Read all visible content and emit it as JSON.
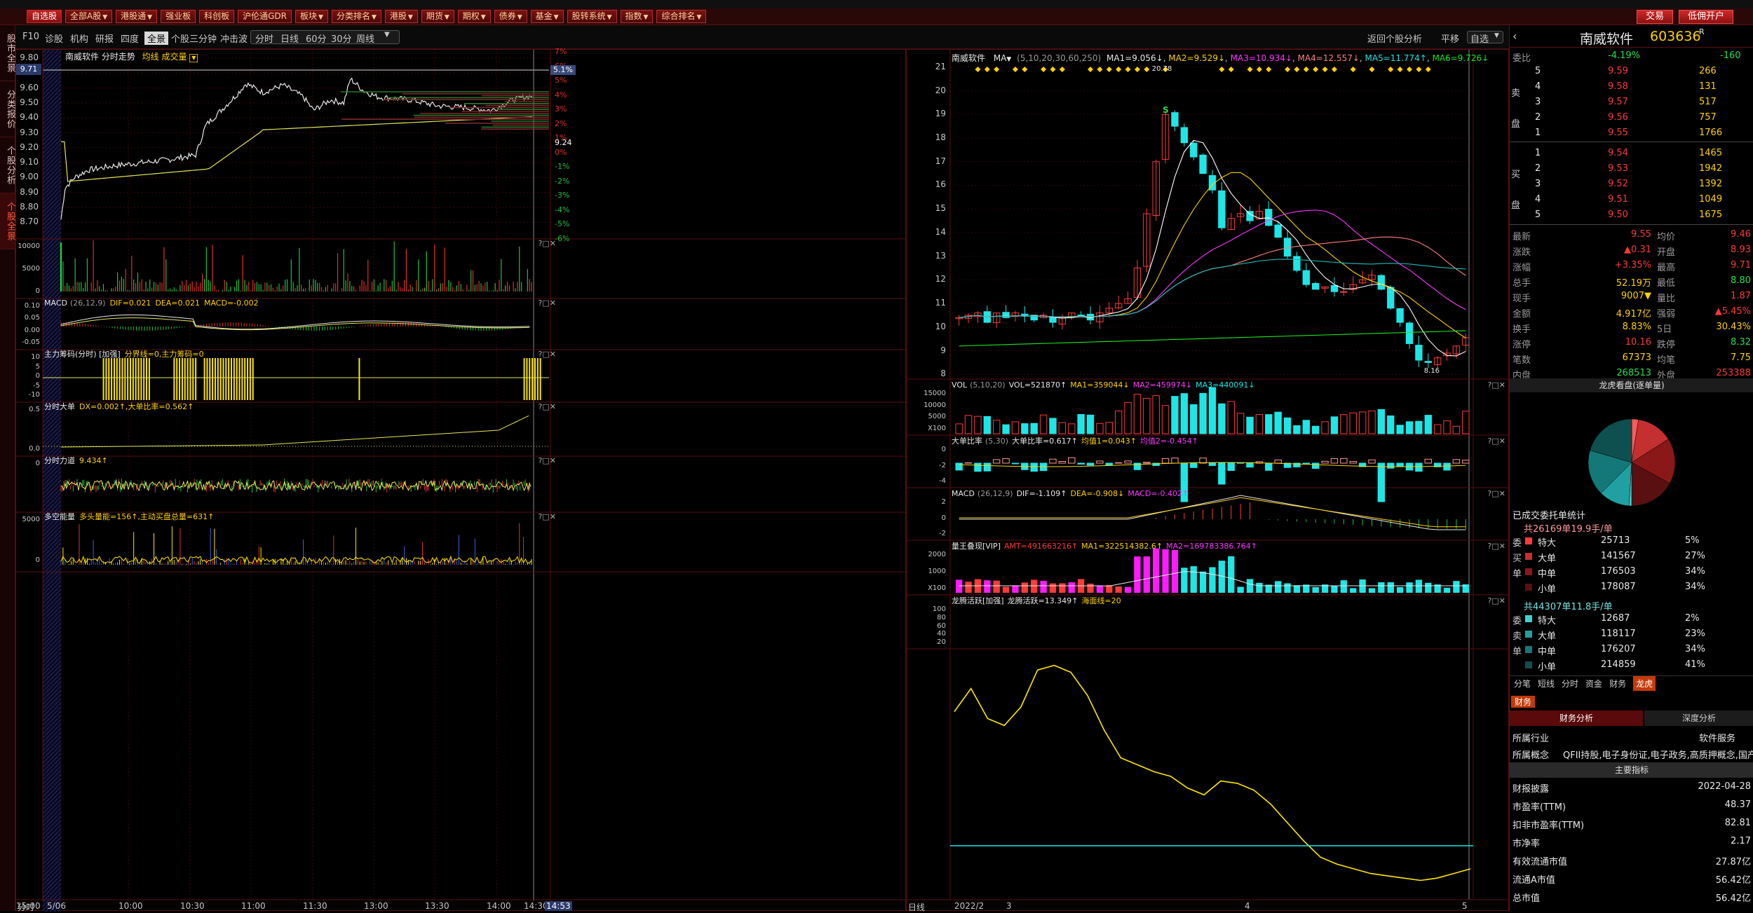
{
  "topbar": {
    "text": ""
  },
  "menu": {
    "items": [
      "自选股",
      "全部A股",
      "港股通",
      "强业板",
      "科创板",
      "沪伦通GDR",
      "板块",
      "分类排名",
      "港股",
      "期货",
      "期权",
      "债券",
      "基金",
      "股转系统",
      "指数",
      "综合排名"
    ],
    "has_arrow": [
      false,
      true,
      true,
      false,
      false,
      false,
      true,
      true,
      true,
      true,
      true,
      true,
      true,
      true,
      true,
      true
    ],
    "active_index": 0,
    "right_buttons": [
      "交易",
      "低佣开户"
    ]
  },
  "sidetabs": [
    "股市全景",
    "分类报价",
    "个股分析",
    "个股全景"
  ],
  "toolbar": {
    "left": [
      "F10",
      "诊股",
      "机构",
      "研报",
      "四度",
      "全景",
      "个股三分钟",
      "冲击波"
    ],
    "period": [
      "分时",
      "日线",
      "60分",
      "30分",
      "周线"
    ],
    "right": [
      "返回个股分析",
      "平移",
      "自选"
    ]
  },
  "intraday": {
    "title": "南威软件  分时走势",
    "title2": "均线 成交量",
    "price_ticks": [
      "9.80",
      "9.70",
      "9.60",
      "9.50",
      "9.40",
      "9.30",
      "9.20",
      "9.10",
      "9.00",
      "8.90",
      "8.80",
      "8.70"
    ],
    "pct_ticks": [
      "7%",
      "6%",
      "5%",
      "4%",
      "3%",
      "2%",
      "1%",
      "0%",
      "-1%",
      "-2%",
      "-3%",
      "-4%",
      "-5%",
      "-6%"
    ],
    "cursor_price": "9.71",
    "cursor_pct": "5.1%",
    "last_label": "9.24",
    "time_labels": [
      "5/06",
      "10:00",
      "10:30",
      "11:00",
      "11:30",
      "13:00",
      "13:30",
      "14:00",
      "14:30",
      "14:53",
      "15:00"
    ],
    "xaxis_left": "分时"
  },
  "sub_intraday": [
    {
      "title": "",
      "ticks": [
        "10000",
        "5000",
        "0"
      ]
    },
    {
      "title": "MACD",
      "params": "(26,12,9)",
      "dif": "DIF=0.021",
      "dea": "DEA=0.021",
      "macd": "MACD=-0.002",
      "ticks": [
        "0.10",
        "0.05",
        "0.00",
        "-0.05"
      ]
    },
    {
      "title": "主力筹码(分时) [加强]",
      "val": "分界线=0,主力筹码=0",
      "ticks": [
        "10",
        "5",
        "0",
        "-5",
        "-10"
      ]
    },
    {
      "title": "分时大单",
      "val": "DX=0.002↑,大单比率=0.562↑",
      "ticks": [
        "0.5",
        "0.0"
      ]
    },
    {
      "title": "分时力道",
      "val": "9.434↑",
      "ticks": [
        "0"
      ]
    },
    {
      "title": "多空能量",
      "val": "多头量能=156↑,主动买盘总量=631↑",
      "ticks": [
        "5000",
        "0"
      ]
    }
  ],
  "kline": {
    "title": "南威软件",
    "ma_title": "MA",
    "ma_params": "(5,10,20,30,60,250)",
    "ma": [
      "MA1=9.056↓",
      "MA2=9.529↓",
      "MA3=10.934↓",
      "MA4=12.557↓",
      "MA5=11.774↑",
      "MA6=9.726↓"
    ],
    "price_ticks": [
      "21",
      "20",
      "19",
      "18",
      "17",
      "16",
      "15",
      "14",
      "13",
      "12",
      "11",
      "10",
      "9",
      "8"
    ],
    "hi_label": "20.78",
    "lo_label": "8.16",
    "s_label": "S",
    "time_labels": [
      "2022/2",
      "3",
      "4",
      "5"
    ],
    "xaxis_left": "日线"
  },
  "sub_kline": [
    {
      "title": "VOL",
      "params": "(5,10,20)",
      "vals": [
        "VOL=521870↑",
        "MA1=359044↓",
        "MA2=459974↓",
        "MA3=440091↓"
      ],
      "ticks": [
        "15000",
        "10000",
        "5000",
        "X100"
      ]
    },
    {
      "title": "大单比率",
      "params": "(5,30)",
      "vals": [
        "大单比率=0.617↑",
        "均值1=0.043↑",
        "均值2=-0.454↑"
      ],
      "ticks": [
        "0",
        "-2",
        "-4"
      ]
    },
    {
      "title": "MACD",
      "params": "(26,12,9)",
      "vals": [
        "DIF=-1.109↑",
        "DEA=-0.908↓",
        "MACD=-0.402↑"
      ],
      "ticks": [
        "2",
        "0",
        "-2"
      ]
    },
    {
      "title": "量王叠现[VIP]",
      "params": "",
      "vals": [
        "AMT=491663216↑",
        "MA1=322514382.6↑",
        "MA2=169783386.764↑"
      ],
      "ticks": [
        "2000",
        "1000",
        "X100"
      ]
    },
    {
      "title": "龙腾活跃[加强]",
      "params": "",
      "vals": [
        "龙腾活跃=13.349↑",
        "海面线=20"
      ],
      "ticks": [
        "100",
        "80",
        "60",
        "40",
        "20"
      ]
    }
  ],
  "right": {
    "name": "南威软件",
    "code": "603636",
    "badge": "R",
    "weibi_label": "委比",
    "weibi": "-4.19%",
    "weibi_vol": "-160",
    "sell": [
      [
        "5",
        "9.59",
        "266"
      ],
      [
        "4",
        "9.58",
        "131"
      ],
      [
        "3",
        "9.57",
        "517"
      ],
      [
        "2",
        "9.56",
        "757"
      ],
      [
        "1",
        "9.55",
        "1766"
      ]
    ],
    "buy": [
      [
        "1",
        "9.54",
        "1465"
      ],
      [
        "2",
        "9.53",
        "1942"
      ],
      [
        "3",
        "9.52",
        "1392"
      ],
      [
        "4",
        "9.51",
        "1049"
      ],
      [
        "5",
        "9.50",
        "1675"
      ]
    ],
    "side_sell": [
      "卖",
      "盘"
    ],
    "side_buy": [
      "买",
      "盘"
    ],
    "stats": [
      [
        "最新",
        "9.55",
        "均价",
        "9.46"
      ],
      [
        "涨跌",
        "▲0.31",
        "开盘",
        "8.93"
      ],
      [
        "涨幅",
        "+3.35%",
        "最高",
        "9.71"
      ],
      [
        "总手",
        "52.19万",
        "最低",
        "8.80"
      ],
      [
        "现手",
        "9007▼",
        "量比",
        "1.87"
      ],
      [
        "金额",
        "4.917亿",
        "强弱",
        "▲5.45%"
      ],
      [
        "换手",
        "8.83%",
        "5日",
        "30.43%"
      ],
      [
        "涨停",
        "10.16",
        "跌停",
        "8.32"
      ],
      [
        "笔数",
        "67373",
        "均笔",
        "7.75"
      ],
      [
        "内盘",
        "268513",
        "外盘",
        "253388"
      ]
    ],
    "pie_title": "龙虎看盘(逐单量)",
    "pie_values": [
      5,
      27,
      34,
      34,
      2,
      23,
      34,
      41
    ],
    "orders_title": "已成交委托单统计",
    "buy_summary": "共26169单19.9手/单",
    "sell_summary": "共44307单11.8手/单",
    "buy_rows": [
      [
        "特大",
        "25713",
        "5%"
      ],
      [
        "大单",
        "141567",
        "27%"
      ],
      [
        "中单",
        "176503",
        "34%"
      ],
      [
        "小单",
        "178087",
        "34%"
      ]
    ],
    "sell_rows": [
      [
        "特大",
        "12687",
        "2%"
      ],
      [
        "大单",
        "118117",
        "23%"
      ],
      [
        "中单",
        "176207",
        "34%"
      ],
      [
        "小单",
        "214859",
        "41%"
      ]
    ],
    "side_wei": [
      "委",
      "买",
      "单"
    ],
    "side_wei2": [
      "委",
      "卖",
      "单"
    ],
    "tabs": [
      "分笔",
      "短线",
      "分时",
      "资金",
      "财务",
      "龙虎"
    ],
    "active_tab": 5,
    "section": "财务",
    "fin_tabs": [
      "财务分析",
      "深度分析"
    ],
    "industry_label": "所属行业",
    "industry": "软件服务",
    "concept_label": "所属概念",
    "concept": "QFII持股,电子身份证,电子政务,高质押概念,国产软件",
    "indicator_title": "主要指标",
    "fin_rows": [
      [
        "财报披露",
        "2022-04-28"
      ],
      [
        "市盈率(TTM)",
        "48.37"
      ],
      [
        "扣非市盈率(TTM)",
        "82.81"
      ],
      [
        "市净率",
        "2.17"
      ],
      [
        "有效流通市值",
        "27.87亿"
      ],
      [
        "流通A市值",
        "56.42亿"
      ],
      [
        "总市值",
        "56.42亿"
      ]
    ]
  },
  "colors": {
    "up": "#ff3a3a",
    "down": "#1ee6e6",
    "accent": "#c43a0a",
    "ma5": "#ffffff",
    "ma10": "#ffd200",
    "ma20": "#ff36ff",
    "ma30": "#1ee61e",
    "ma60": "#ff8080",
    "ma250": "#1ebebe"
  }
}
